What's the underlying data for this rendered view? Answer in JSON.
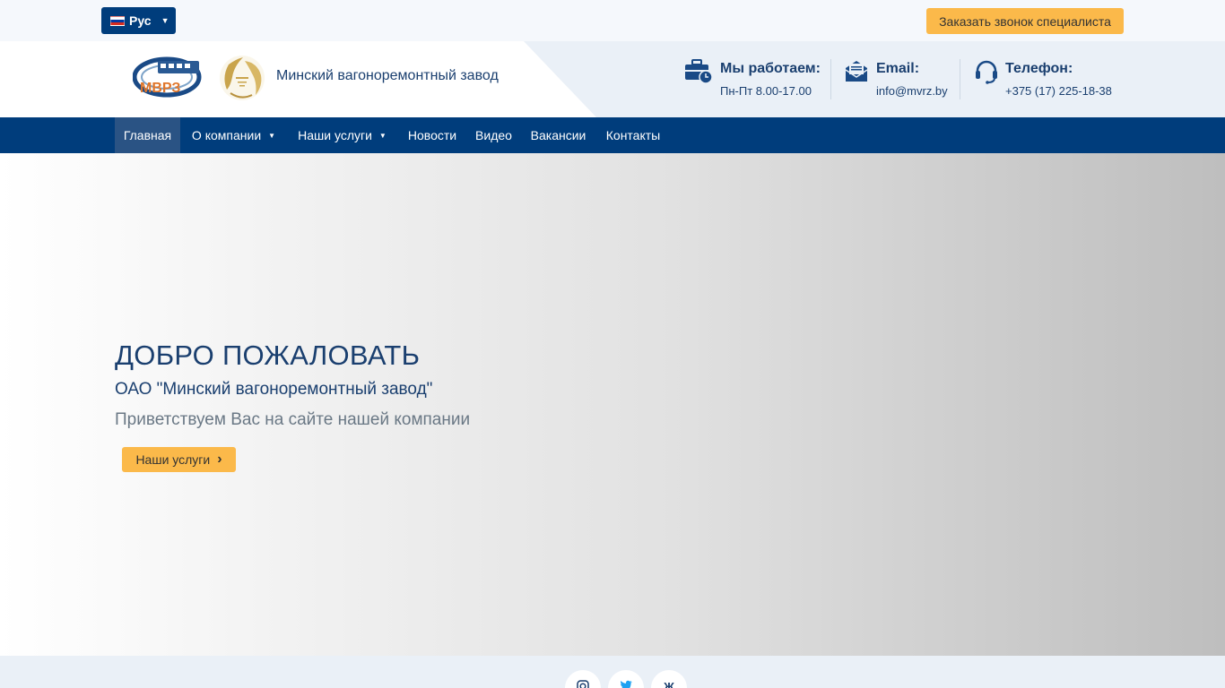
{
  "topbar": {
    "language": "Рус",
    "callback_button": "Заказать звонок специалиста"
  },
  "header": {
    "logo_text": "МВРЗ",
    "company_name": "Минский вагоноремонтный завод",
    "hours": {
      "title": "Мы работаем:",
      "value": "Пн-Пт 8.00-17.00"
    },
    "email": {
      "title": "Email:",
      "value": "info@mvrz.by"
    },
    "phone": {
      "title": "Телефон:",
      "value": "+375 (17) 225-18-38"
    }
  },
  "nav": {
    "items": [
      {
        "label": "Главная",
        "active": true
      },
      {
        "label": "О компании",
        "dropdown": true
      },
      {
        "label": "Наши услуги",
        "dropdown": true
      },
      {
        "label": "Новости"
      },
      {
        "label": "Видео"
      },
      {
        "label": "Вакансии"
      },
      {
        "label": "Контакты"
      }
    ]
  },
  "hero": {
    "title": "ДОБРО ПОЖАЛОВАТЬ",
    "subtitle": "ОАО \"Минский вагоноремонтный завод\"",
    "text": "Приветствуем Вас на сайте нашей компании",
    "button": "Наши услуги"
  },
  "social": {
    "items": [
      {
        "icon": "instagram-icon"
      },
      {
        "icon": "twitter-icon"
      },
      {
        "icon": "vk-icon",
        "glyph": "Ж"
      }
    ]
  },
  "colors": {
    "brand_blue": "#003d7c",
    "accent_yellow": "#fbb94a",
    "text_dark_blue": "#1a3f6f",
    "header_bg": "#eaf0f7"
  }
}
